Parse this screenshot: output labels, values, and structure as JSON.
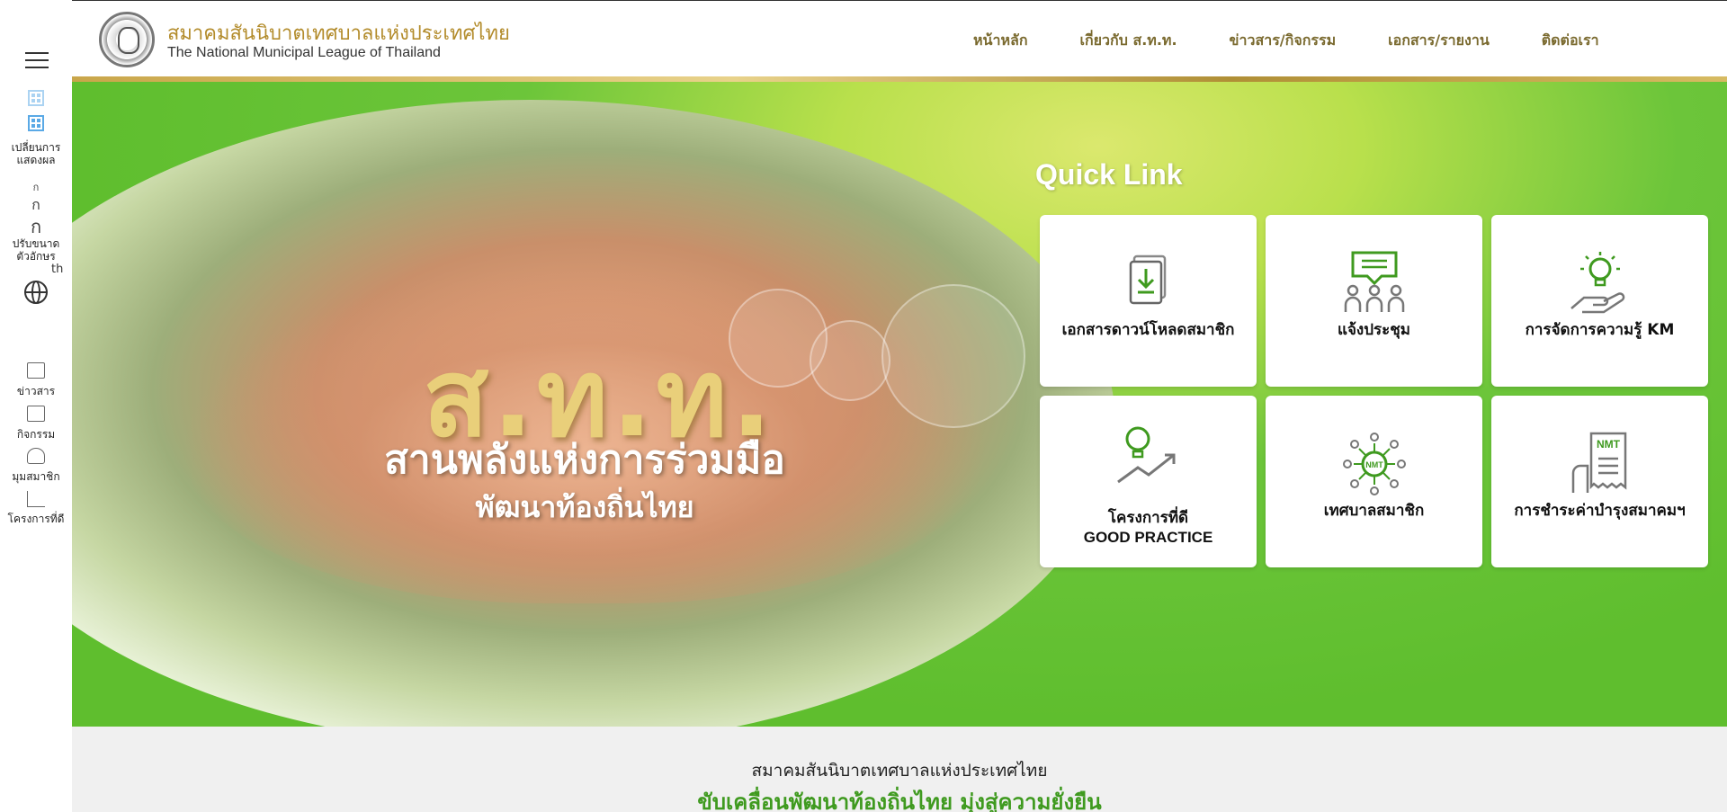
{
  "sidebar": {
    "menu_icon": "hamburger-icon",
    "layout_label_line1": "เปลี่ยนการ",
    "layout_label_line2": "แสดงผล",
    "font_small": "ก",
    "font_medium": "ก",
    "font_large": "ก",
    "font_label_line1": "ปรับขนาด",
    "font_label_line2": "ตัวอักษร",
    "lang_code": "th",
    "items": [
      {
        "label": "ข่าวสาร",
        "icon": "news-icon"
      },
      {
        "label": "กิจกรรม",
        "icon": "image-icon"
      },
      {
        "label": "มุมสมาชิก",
        "icon": "members-icon"
      },
      {
        "label": "โครงการที่ดี",
        "icon": "project-icon"
      }
    ]
  },
  "header": {
    "org_name_th": "สมาคมสันนิบาตเทศบาลแห่งประเทศไทย",
    "org_name_en": "The National Municipal League of Thailand",
    "nav": [
      "หน้าหลัก",
      "เกี่ยวกับ ส.ท.ท.",
      "ข่าวสาร/กิจกรรม",
      "เอกสาร/รายงาน",
      "ติดต่อเรา"
    ]
  },
  "hero": {
    "brand": "ส.ท.ท.",
    "slogan_line1": "สานพลังแห่งการร่วมมือ",
    "slogan_line2": "พัฒนาท้องถิ่นไทย"
  },
  "quick_link": {
    "title": "Quick Link",
    "cards": [
      {
        "label": "เอกสารดาวน์โหลดสมาชิก",
        "label2": "",
        "icon": "document-download-icon"
      },
      {
        "label": "แจ้งประชุม",
        "label2": "",
        "icon": "meeting-icon"
      },
      {
        "label": "การจัดการความรู้ KM",
        "label2": "",
        "icon": "lightbulb-hand-icon"
      },
      {
        "label": "โครงการที่ดี",
        "label2": "GOOD PRACTICE",
        "icon": "lightbulb-growth-icon"
      },
      {
        "label": "เทศบาลสมาชิก",
        "label2": "",
        "icon": "network-nmt-icon"
      },
      {
        "label": "การชำระค่าบำรุงสมาคมฯ",
        "label2": "",
        "icon": "receipt-nmt-icon"
      }
    ],
    "icon_badge": "NMT"
  },
  "band": {
    "line1": "สมาคมสันนิบาตเทศบาลแห่งประเทศไทย",
    "line2": "ขับเคลื่อนพัฒนาท้องถิ่นไทย มุ่งสู่ความยั่งยืน"
  },
  "colors": {
    "gold": "#b38c2c",
    "nav": "#7a6a2f",
    "green": "#5fbe2e",
    "icon_green": "#3f9a1f"
  }
}
